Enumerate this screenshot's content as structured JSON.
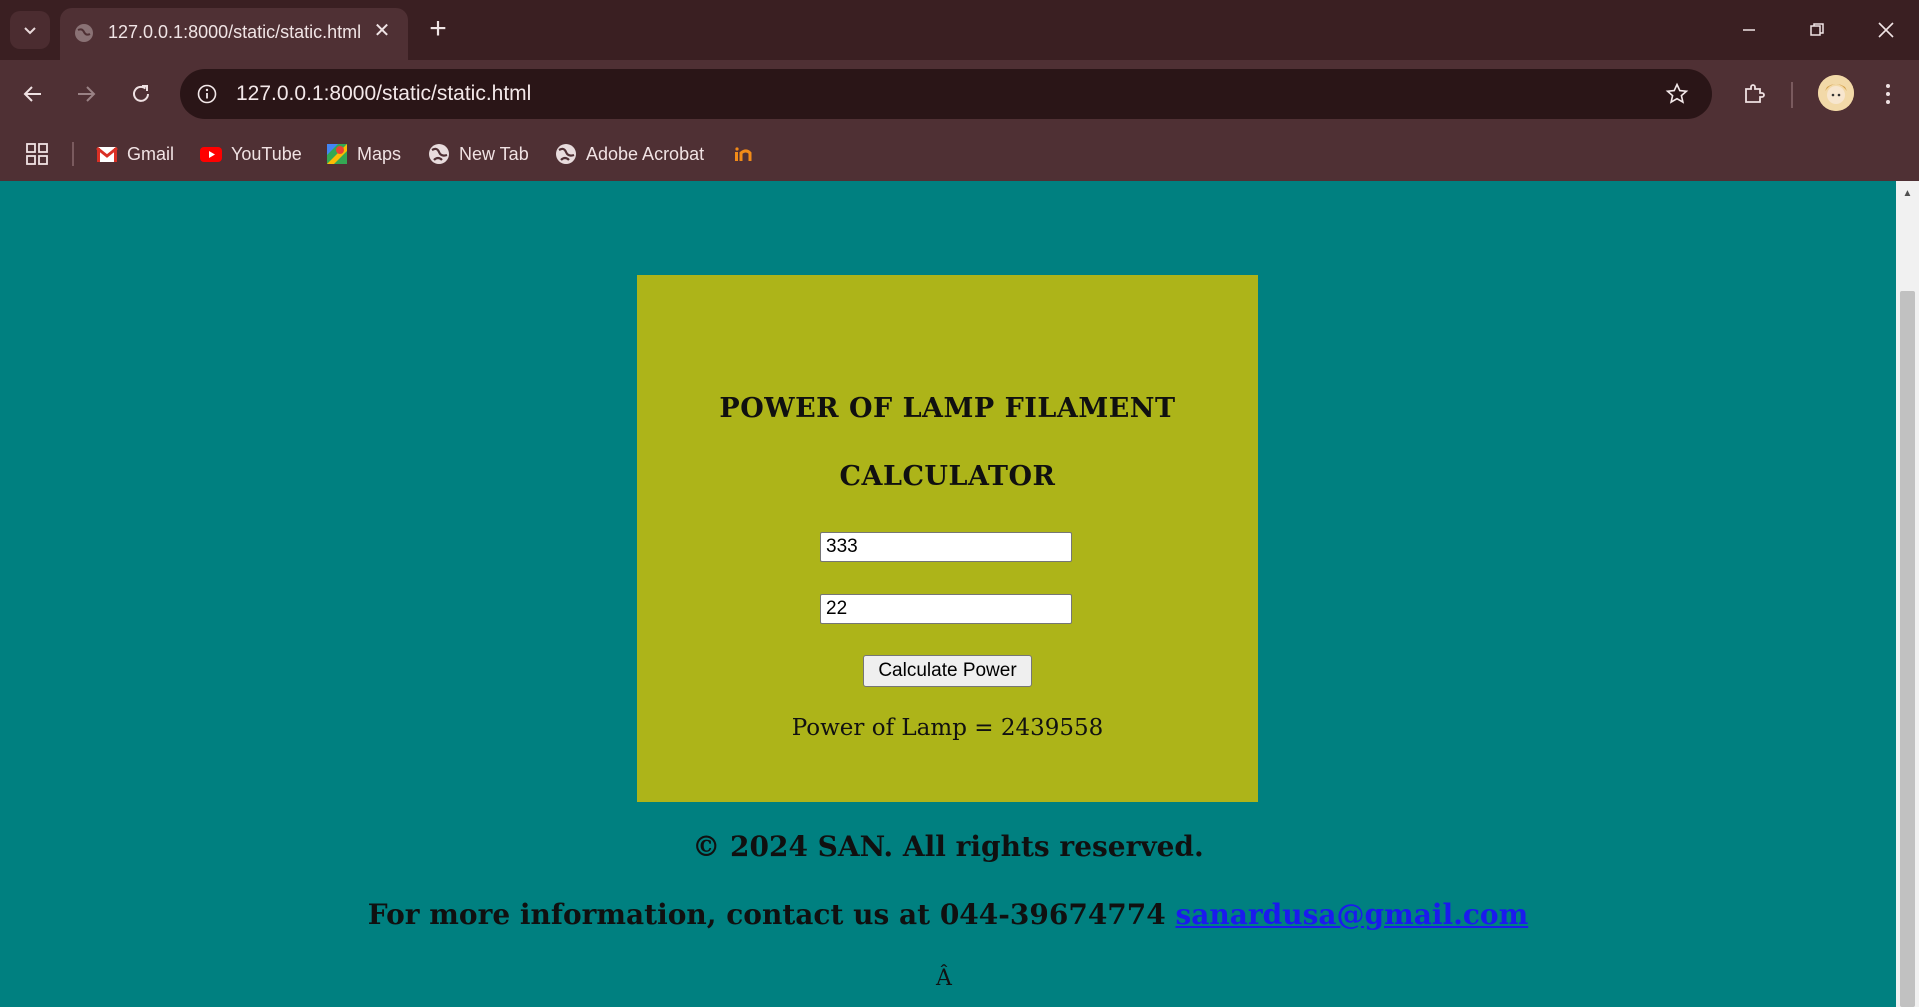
{
  "browser": {
    "tab_title": "127.0.0.1:8000/static/static.html",
    "url": "127.0.0.1:8000/static/static.html",
    "bookmarks": [
      {
        "label": "Gmail",
        "icon": "gmail-icon"
      },
      {
        "label": "YouTube",
        "icon": "youtube-icon"
      },
      {
        "label": "Maps",
        "icon": "maps-icon"
      },
      {
        "label": "New Tab",
        "icon": "globe-icon"
      },
      {
        "label": "Adobe Acrobat",
        "icon": "globe-icon"
      }
    ],
    "colors": {
      "tabbar": "#3a1f22",
      "toolbar": "#4f3034",
      "omnibox": "#2a1517"
    }
  },
  "page": {
    "heading_line1": "POWER OF LAMP FILAMENT",
    "heading_line2": "CALCULATOR",
    "input1_value": "333",
    "input2_value": "22",
    "button_label": "Calculate Power",
    "result_label": "Power of Lamp = ",
    "result_value": "2439558",
    "footer_copyright": "© 2024 SAN. All rights reserved.",
    "footer_contact": "For more information, contact us at 044-39674774 ",
    "footer_email": "sanardusa@gmail.com",
    "stray_glyph": "Â",
    "colors": {
      "background": "#008080",
      "card": "#adb419",
      "link": "#1a1aee"
    }
  }
}
